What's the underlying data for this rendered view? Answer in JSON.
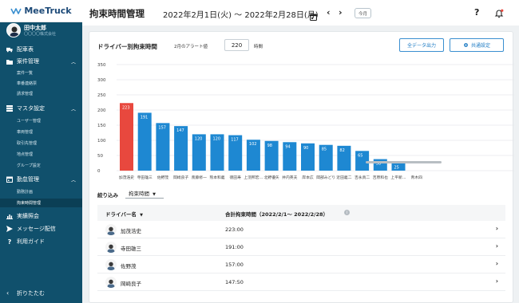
{
  "app": {
    "logo": "MeeTruck"
  },
  "user": {
    "name": "田中太郎",
    "company": "〇〇〇〇株式会社"
  },
  "sidebar": {
    "items": [
      {
        "label": "配車表",
        "icon": "truck-icon"
      },
      {
        "label": "案件管理",
        "icon": "folder-icon",
        "expanded": true,
        "children": [
          "案件一覧",
          "車番連絡票",
          "請求管理"
        ]
      },
      {
        "label": "マスタ設定",
        "icon": "database-icon",
        "expanded": true,
        "children": [
          "ユーザー管理",
          "車両管理",
          "取引先管理",
          "地点管理",
          "グループ設定"
        ]
      },
      {
        "label": "勤怠管理",
        "icon": "calendar-icon",
        "expanded": true,
        "children": [
          "勤務計画",
          "拘束時間管理"
        ]
      },
      {
        "label": "実績照会",
        "icon": "bar-chart-icon"
      },
      {
        "label": "メッセージ配信",
        "icon": "send-icon"
      },
      {
        "label": "利用ガイド",
        "icon": "help-icon"
      }
    ],
    "active_child": "拘束時間管理",
    "collapse_label": "折りたたむ"
  },
  "header": {
    "title": "拘束時間管理",
    "date_range": "2022年2月1日(火) 〜 2022年2月28日(月)",
    "this_month": "今月"
  },
  "panel": {
    "title": "ドライバー別拘束時間",
    "alert_label": "2月のアラート値",
    "alert_value": "220",
    "alert_unit": "時間",
    "export_label": "全データ出力",
    "share_label": "共通設定"
  },
  "chart_data": {
    "type": "bar",
    "categories": [
      "加茂浩史",
      "寺田雄三",
      "佐野茂",
      "岡崎良子",
      "斎藤修一",
      "熊本和義",
      "徳田寿",
      "上羽邦宏…",
      "北野優矢",
      "井内英夫",
      "岸本広",
      "岡部みどり",
      "近田義二",
      "吉永真二",
      "吉原和也",
      "上平新…",
      "青木四"
    ],
    "values": [
      223,
      191,
      157,
      147,
      120,
      120,
      117,
      102,
      98,
      94,
      90,
      85,
      82,
      65,
      38,
      25,
      0
    ],
    "ylim": [
      0,
      350
    ],
    "yticks": [
      0,
      50,
      100,
      150,
      200,
      250,
      300,
      350
    ],
    "alert": 220,
    "colors": {
      "normal": "#1e88d2",
      "alert": "#e8483e",
      "grid": "#e6e9ec",
      "scroll": "#b8bec3"
    }
  },
  "filter": {
    "label": "絞り込み",
    "value": "拘束時間"
  },
  "table": {
    "col_name": "ドライバー名",
    "col_total": "合計拘束時間（2022/2/1〜 2022/2/28）",
    "rows": [
      {
        "name": "加茂浩史",
        "total": "223:00"
      },
      {
        "name": "寺田雄三",
        "total": "191:00"
      },
      {
        "name": "佐野茂",
        "total": "157:00"
      },
      {
        "name": "岡崎良子",
        "total": "147:50"
      }
    ]
  }
}
